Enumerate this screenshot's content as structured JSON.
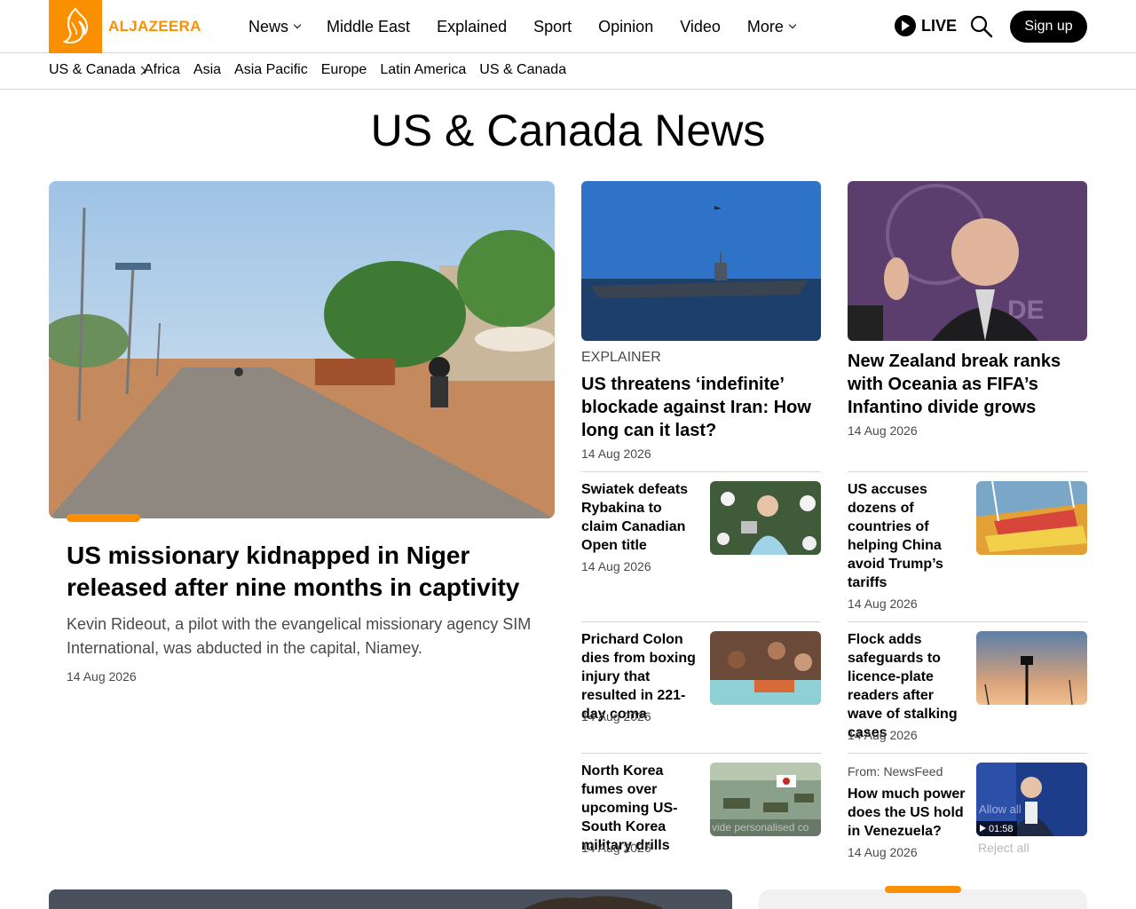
{
  "brand": {
    "name": "ALJAZEERA"
  },
  "nav": {
    "items": [
      {
        "label": "News",
        "dropdown": true
      },
      {
        "label": "Middle East",
        "dropdown": false
      },
      {
        "label": "Explained",
        "dropdown": false
      },
      {
        "label": "Sport",
        "dropdown": false
      },
      {
        "label": "Opinion",
        "dropdown": false
      },
      {
        "label": "Video",
        "dropdown": false
      },
      {
        "label": "More",
        "dropdown": true
      }
    ],
    "live_label": "LIVE",
    "signup_label": "Sign up"
  },
  "subnav": {
    "current": "US & Canada",
    "regions": [
      "Africa",
      "Asia",
      "Asia Pacific",
      "Europe",
      "Latin America",
      "US & Canada"
    ]
  },
  "page_title": "US & Canada News",
  "lead": {
    "title": "US missionary kidnapped in Niger released after nine months in captivity",
    "summary": "Kevin Rideout, a pilot with the evangelical missionary agency SIM International, was abducted in the capital, Niamey.",
    "date": "14 Aug 2026"
  },
  "feature_cards": [
    {
      "kicker": "EXPLAINER",
      "title": "US threatens ‘indefinite’ blockade against Iran: How long can it last?",
      "date": "14 Aug 2026"
    },
    {
      "title": "New Zealand break ranks with Oceania as FIFA’s Infantino divide grows",
      "date": "14 Aug 2026"
    }
  ],
  "small_cards": {
    "left": [
      {
        "title": "Swiatek defeats Rybakina to claim Canadian Open title",
        "date": "14 Aug 2026"
      },
      {
        "title": "Prichard Colon dies from boxing injury that resulted in 221-day coma",
        "date": "14 Aug 2026"
      },
      {
        "title": "North Korea fumes over upcoming US-South Korea military drills",
        "date": "14 Aug 2026",
        "overlay": "vide personalised co"
      }
    ],
    "right": [
      {
        "title": "US accuses dozens of countries of helping China avoid Trump’s tariffs",
        "date": "14 Aug 2026"
      },
      {
        "title": "Flock adds safeguards to licence-plate readers after wave of stalking cases",
        "date": "14 Aug 2026"
      },
      {
        "kicker": "From: NewsFeed",
        "title": "How much power does the US hold in Venezuela?",
        "date": "14 Aug 2026",
        "duration": "01:58",
        "overlay_allow": "Allow all",
        "overlay_reject": "Reject all"
      }
    ]
  },
  "colors": {
    "accent": "#fa9000",
    "text": "#000000",
    "muted": "#4a4a4a",
    "divider": "#d6d6d6"
  }
}
